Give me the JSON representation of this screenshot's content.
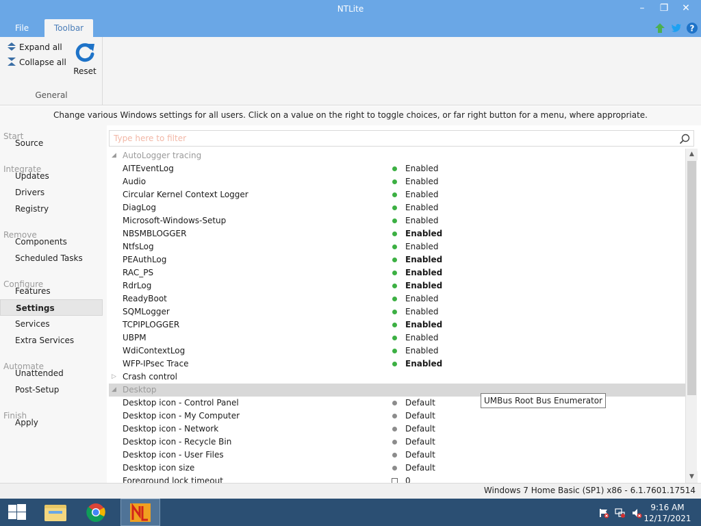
{
  "window": {
    "title": "NTLite",
    "minimize_glyph": "–",
    "restore_glyph": "❐",
    "close_glyph": "✕"
  },
  "menu": {
    "file": "File",
    "toolbar": "Toolbar",
    "icons": [
      "upgrade-arrow-icon",
      "twitter-icon",
      "help-icon"
    ]
  },
  "ribbon": {
    "expand_all": "Expand all",
    "collapse_all": "Collapse all",
    "reset": "Reset",
    "group_label": "General"
  },
  "description": "Change various Windows settings for all users. Click on a value on the right to toggle choices, or far right button for a menu, where appropriate.",
  "sidebar": {
    "sections": [
      {
        "label": "Start",
        "items": [
          "Source"
        ]
      },
      {
        "label": "Integrate",
        "items": [
          "Updates",
          "Drivers",
          "Registry"
        ]
      },
      {
        "label": "Remove",
        "items": [
          "Components",
          "Scheduled Tasks"
        ]
      },
      {
        "label": "Configure",
        "items": [
          "Features",
          "Settings",
          "Services",
          "Extra Services"
        ]
      },
      {
        "label": "Automate",
        "items": [
          "Unattended",
          "Post-Setup"
        ]
      },
      {
        "label": "Finish",
        "items": [
          "Apply"
        ]
      }
    ],
    "selected": "Settings"
  },
  "search": {
    "placeholder": "Type here to filter",
    "value": ""
  },
  "tree": {
    "groups": [
      {
        "label": "AutoLogger tracing",
        "expanded": true,
        "rows": [
          {
            "name": "AITEventLog",
            "value": "Enabled",
            "bold": false,
            "status": "green"
          },
          {
            "name": "Audio",
            "value": "Enabled",
            "bold": false,
            "status": "green"
          },
          {
            "name": "Circular Kernel Context Logger",
            "value": "Enabled",
            "bold": false,
            "status": "green"
          },
          {
            "name": "DiagLog",
            "value": "Enabled",
            "bold": false,
            "status": "green"
          },
          {
            "name": "Microsoft-Windows-Setup",
            "value": "Enabled",
            "bold": false,
            "status": "green"
          },
          {
            "name": "NBSMBLOGGER",
            "value": "Enabled",
            "bold": true,
            "status": "green"
          },
          {
            "name": "NtfsLog",
            "value": "Enabled",
            "bold": false,
            "status": "green"
          },
          {
            "name": "PEAuthLog",
            "value": "Enabled",
            "bold": true,
            "status": "green"
          },
          {
            "name": "RAC_PS",
            "value": "Enabled",
            "bold": true,
            "status": "green"
          },
          {
            "name": "RdrLog",
            "value": "Enabled",
            "bold": true,
            "status": "green"
          },
          {
            "name": "ReadyBoot",
            "value": "Enabled",
            "bold": false,
            "status": "green"
          },
          {
            "name": "SQMLogger",
            "value": "Enabled",
            "bold": false,
            "status": "green"
          },
          {
            "name": "TCPIPLOGGER",
            "value": "Enabled",
            "bold": true,
            "status": "green"
          },
          {
            "name": "UBPM",
            "value": "Enabled",
            "bold": false,
            "status": "green"
          },
          {
            "name": "WdiContextLog",
            "value": "Enabled",
            "bold": false,
            "status": "green"
          },
          {
            "name": "WFP-IPsec Trace",
            "value": "Enabled",
            "bold": true,
            "status": "green"
          }
        ]
      },
      {
        "label": "Crash control",
        "expanded": false,
        "rows": []
      },
      {
        "label": "Desktop",
        "expanded": true,
        "highlight": true,
        "rows": [
          {
            "name": "Desktop icon - Control Panel",
            "value": "Default",
            "bold": false,
            "status": "gray"
          },
          {
            "name": "Desktop icon - My Computer",
            "value": "Default",
            "bold": false,
            "status": "gray"
          },
          {
            "name": "Desktop icon - Network",
            "value": "Default",
            "bold": false,
            "status": "gray"
          },
          {
            "name": "Desktop icon - Recycle Bin",
            "value": "Default",
            "bold": false,
            "status": "gray"
          },
          {
            "name": "Desktop icon - User Files",
            "value": "Default",
            "bold": false,
            "status": "gray"
          },
          {
            "name": "Desktop icon size",
            "value": "Default",
            "bold": false,
            "status": "gray"
          },
          {
            "name": "Foreground lock timeout",
            "value": "0",
            "bold": false,
            "status": "box"
          }
        ]
      }
    ]
  },
  "tooltip": "UMBus Root Bus Enumerator",
  "status": "Windows 7 Home Basic (SP1) x86 - 6.1.7601.17514",
  "taskbar": {
    "apps": [
      "start-button",
      "file-explorer",
      "chrome",
      "ntlite"
    ],
    "time": "9:16 AM",
    "date": "12/17/2021"
  },
  "colors": {
    "titlebar": "#6aa7e6",
    "taskbar": "#2b4f73",
    "enabled_dot": "#3cb043",
    "default_dot": "#8c8c8c"
  }
}
